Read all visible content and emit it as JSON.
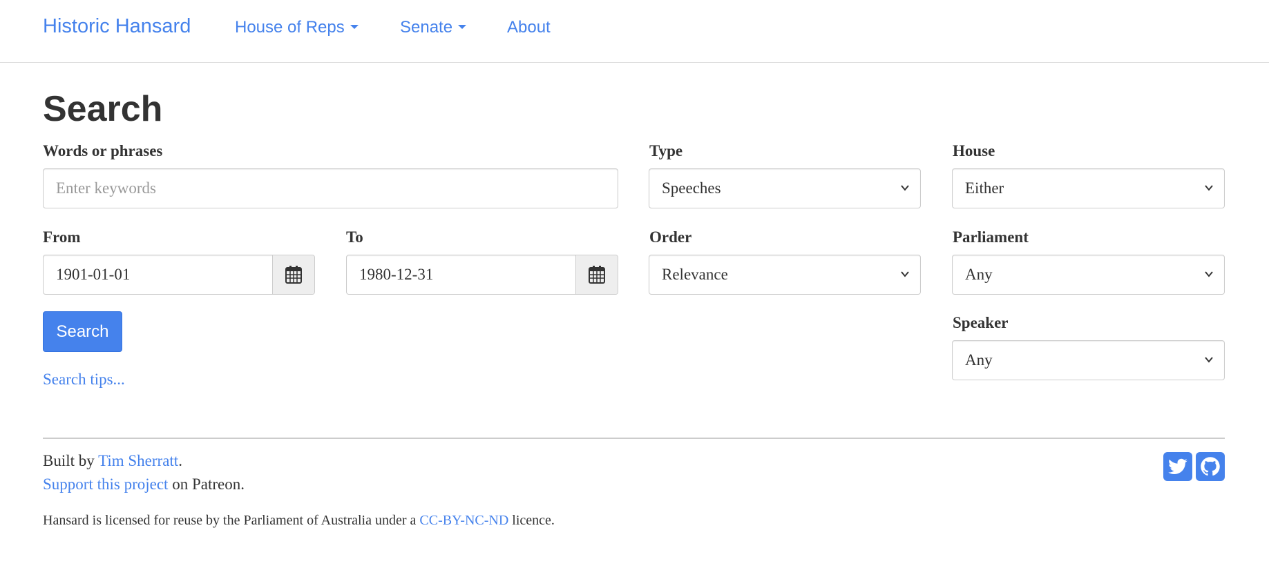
{
  "navbar": {
    "brand": "Historic Hansard",
    "items": [
      {
        "label": "House of Reps",
        "dropdown": true
      },
      {
        "label": "Senate",
        "dropdown": true
      },
      {
        "label": "About",
        "dropdown": false
      }
    ]
  },
  "page_title": "Search",
  "form": {
    "keywords": {
      "label": "Words or phrases",
      "placeholder": "Enter keywords",
      "value": ""
    },
    "type": {
      "label": "Type",
      "value": "Speeches"
    },
    "house": {
      "label": "House",
      "value": "Either"
    },
    "from": {
      "label": "From",
      "value": "1901-01-01"
    },
    "to": {
      "label": "To",
      "value": "1980-12-31"
    },
    "order": {
      "label": "Order",
      "value": "Relevance"
    },
    "parliament": {
      "label": "Parliament",
      "value": "Any"
    },
    "speaker": {
      "label": "Speaker",
      "value": "Any"
    },
    "search_button": "Search",
    "tips_link": "Search tips..."
  },
  "footer": {
    "built_prefix": "Built by ",
    "author": "Tim Sherratt",
    "built_suffix": ".",
    "support_link": "Support this project",
    "support_suffix": " on Patreon.",
    "license_prefix": "Hansard is licensed for reuse by the Parliament of Australia under a ",
    "license_link": "CC-BY-NC-ND",
    "license_suffix": " licence.",
    "social_icons": [
      "twitter-icon",
      "github-icon"
    ]
  },
  "colors": {
    "accent": "#4582ec",
    "text": "#333333",
    "border": "#cccccc",
    "addon_bg": "#eeeeee"
  }
}
